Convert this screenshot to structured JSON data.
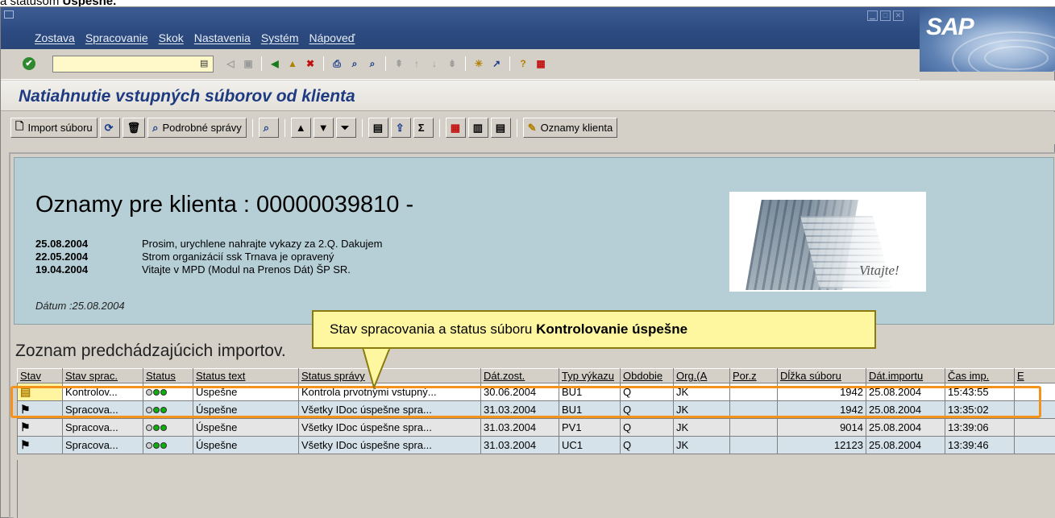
{
  "caption": {
    "prefix": "a statusom ",
    "bold": "Úspešné."
  },
  "menubar": {
    "items": [
      "Zostava",
      "Spracovanie",
      "Skok",
      "Nastavenia",
      "Systém",
      "Nápoveď"
    ],
    "logo": "SAP"
  },
  "std_toolbar": {
    "command_value": ""
  },
  "screen": {
    "title": "Natiahnutie vstupných súborov od klienta"
  },
  "app_toolbar": {
    "import_label": "Import súboru",
    "details_label": "Podrobné správy",
    "notices_label": "Oznamy klienta"
  },
  "notice": {
    "heading": "Oznamy pre klienta : 00000039810 -",
    "items": [
      {
        "date": "25.08.2004",
        "text": "Prosim, urychlene nahrajte vykazy za 2.Q. Dakujem"
      },
      {
        "date": "22.05.2004",
        "text": "Strom organizácií ssk Trnava je opravený"
      },
      {
        "date": "19.04.2004",
        "text": "Vitajte v MPD (Modul na Prenos Dát) ŠP SR."
      }
    ],
    "date_line": "Dátum :25.08.2004",
    "image_text": "Vitajte!"
  },
  "list": {
    "title": "Zoznam predchádzajúcich importov.",
    "columns": [
      "Stav",
      "Stav sprac.",
      "Status",
      "Status text",
      "Status správy",
      "Dát.zost.",
      "Typ výkazu",
      "Obdobie",
      "Org.(A",
      "Por.z",
      "Dĺžka súboru",
      "Dát.importu",
      "Čas imp.",
      "E"
    ],
    "rows": [
      {
        "stav_sprac": "Kontrolov...",
        "status_text": "Úspešne",
        "status_msg": "Kontrola prvotnými vstupný...",
        "dat_zost": "30.06.2004",
        "typ": "BU1",
        "obdobie": "Q",
        "org": "JK",
        "por": "",
        "dlzka": "1942",
        "dat_imp": "25.08.2004",
        "cas": "15:43:55"
      },
      {
        "stav_sprac": "Spracova...",
        "status_text": "Úspešne",
        "status_msg": "Všetky IDoc úspešne spra...",
        "dat_zost": "31.03.2004",
        "typ": "BU1",
        "obdobie": "Q",
        "org": "JK",
        "por": "",
        "dlzka": "1942",
        "dat_imp": "25.08.2004",
        "cas": "13:35:02"
      },
      {
        "stav_sprac": "Spracova...",
        "status_text": "Úspešne",
        "status_msg": "Všetky IDoc úspešne spra...",
        "dat_zost": "31.03.2004",
        "typ": "PV1",
        "obdobie": "Q",
        "org": "JK",
        "por": "",
        "dlzka": "9014",
        "dat_imp": "25.08.2004",
        "cas": "13:39:06"
      },
      {
        "stav_sprac": "Spracova...",
        "status_text": "Úspešne",
        "status_msg": "Všetky IDoc úspešne spra...",
        "dat_zost": "31.03.2004",
        "typ": "UC1",
        "obdobie": "Q",
        "org": "JK",
        "por": "",
        "dlzka": "12123",
        "dat_imp": "25.08.2004",
        "cas": "13:39:46"
      }
    ]
  },
  "callout": {
    "prefix": "Stav spracovania a status súboru ",
    "bold": "Kontrolovanie úspešne"
  },
  "colors": {
    "highlight": "#f4931c",
    "callout_bg": "#fff7a0",
    "title_blue": "#1e3a80"
  }
}
